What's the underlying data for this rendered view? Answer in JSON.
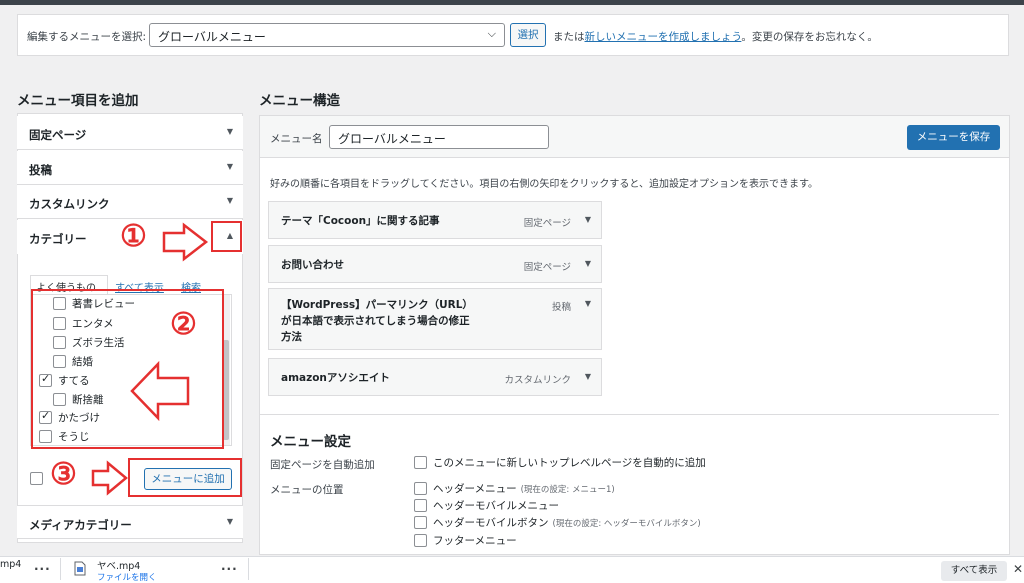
{
  "select_bar": {
    "label": "編集するメニューを選択:",
    "selected_menu": "グローバルメニュー",
    "select_button": "選択",
    "or_prefix": "または",
    "create_link": "新しいメニューを作成しましょう",
    "suffix": "。変更の保存をお忘れなく。"
  },
  "left": {
    "heading": "メニュー項目を追加",
    "accordion": [
      "固定ページ",
      "投稿",
      "カスタムリンク",
      "カテゴリー",
      "メディアカテゴリー"
    ],
    "tabs": [
      "よく使うもの",
      "すべて表示",
      "検索"
    ],
    "categories": [
      {
        "label": "著書レビュー",
        "checked": false,
        "indent": true
      },
      {
        "label": "エンタメ",
        "checked": false,
        "indent": true
      },
      {
        "label": "ズボラ生活",
        "checked": false,
        "indent": true
      },
      {
        "label": "結婚",
        "checked": false,
        "indent": true
      },
      {
        "label": "すてる",
        "checked": true,
        "indent": false
      },
      {
        "label": "断捨離",
        "checked": false,
        "indent": true
      },
      {
        "label": "かたづけ",
        "checked": true,
        "indent": false
      },
      {
        "label": "そうじ",
        "checked": false,
        "indent": false
      }
    ],
    "add_button": "メニューに追加"
  },
  "annotations": [
    "①",
    "②",
    "③"
  ],
  "right": {
    "heading": "メニュー構造",
    "menu_name_label": "メニュー名",
    "menu_name_value": "グローバルメニュー",
    "save_button": "メニューを保存",
    "instructions": "好みの順番に各項目をドラッグしてください。項目の右側の矢印をクリックすると、追加設定オプションを表示できます。",
    "items": [
      {
        "title": "テーマ「Cocoon」に関する記事",
        "type": "固定ページ"
      },
      {
        "title": "お問い合わせ",
        "type": "固定ページ"
      },
      {
        "title": "【WordPress】パーマリンク（URL）が日本語で表示されてしまう場合の修正方法",
        "type": "投稿"
      },
      {
        "title": "amazonアソシエイト",
        "type": "カスタムリンク"
      }
    ],
    "settings": {
      "heading": "メニュー設定",
      "auto_add_label": "固定ページを自動追加",
      "auto_add_option": "このメニューに新しいトップレベルページを自動的に追加",
      "location_label": "メニューの位置",
      "locations": [
        {
          "label": "ヘッダーメニュー",
          "note": "(現在の設定: メニュー1)"
        },
        {
          "label": "ヘッダーモバイルメニュー",
          "note": ""
        },
        {
          "label": "ヘッダーモバイルボタン",
          "note": "(現在の設定: ヘッダーモバイルボタン)"
        },
        {
          "label": "フッターメニュー",
          "note": ""
        }
      ]
    }
  },
  "downloads": {
    "item1_name": "mp4",
    "item2_name": "ヤベ.mp4",
    "item2_action": "ファイルを開く",
    "show_all": "すべて表示"
  },
  "colors": {
    "accent": "#2271b1",
    "annotation_red": "#e53030"
  }
}
